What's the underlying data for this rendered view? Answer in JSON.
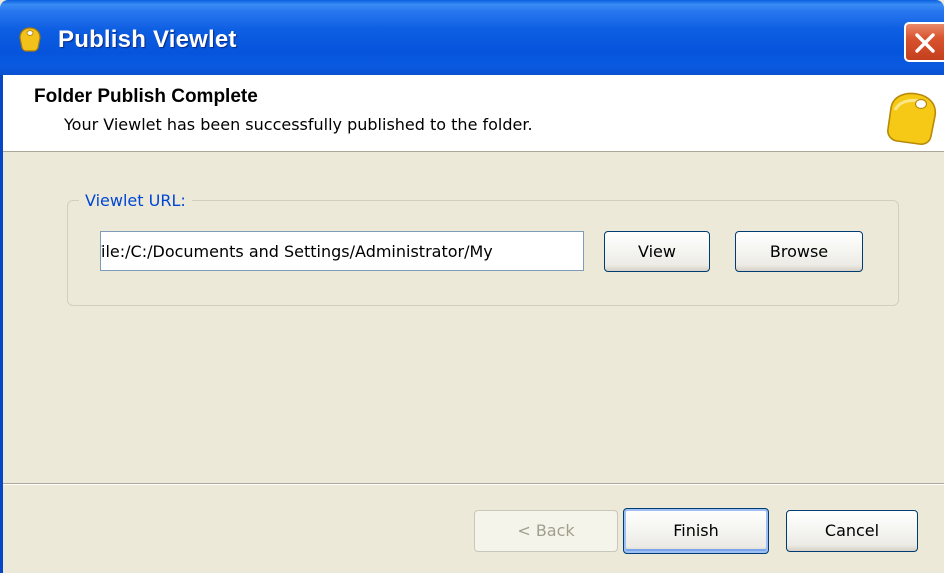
{
  "window": {
    "title": "Publish Viewlet",
    "close_icon": "close-icon",
    "app_icon": "viewlet-tag-icon"
  },
  "header": {
    "title": "Folder Publish Complete",
    "subtitle": "Your Viewlet has been successfully published to the folder.",
    "icon": "viewlet-tag-icon"
  },
  "url_group": {
    "label": "Viewlet URL:",
    "url_value": "File:/C:/Documents and Settings/Administrator/My",
    "view_label": "View",
    "browse_label": "Browse"
  },
  "footer": {
    "back_label": "< Back",
    "finish_label": "Finish",
    "cancel_label": "Cancel"
  },
  "colors": {
    "titlebar": "#0654dc",
    "dialog_bg": "#ece9d8",
    "group_label": "#0046d5",
    "close_button": "#d8532e"
  }
}
